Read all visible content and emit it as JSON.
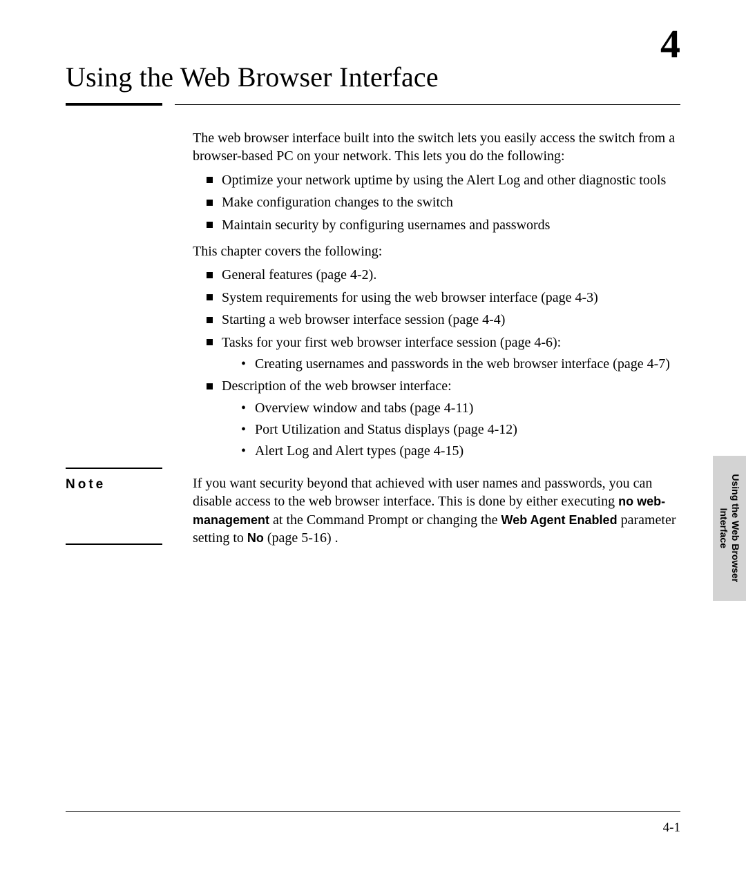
{
  "chapter_number": "4",
  "title": "Using the Web Browser Interface",
  "intro": "The web browser interface built into the switch lets you easily access the switch from a browser-based PC on your network. This lets you do the following:",
  "intro_bullets": [
    "Optimize your network uptime by using the Alert Log and other diagnostic tools",
    "Make configuration changes to the switch",
    "Maintain security by configuring usernames and passwords"
  ],
  "covers_line": "This chapter covers the following:",
  "topics": [
    "General features (page 4-2).",
    "System requirements for using the web browser interface (page 4-3)",
    "Starting a web browser interface session (page 4-4)",
    "Tasks for your first web browser interface session (page 4-6):",
    "Description of the web browser interface:"
  ],
  "subtopics_tasks": [
    "Creating usernames and passwords in the web browser interface (page 4-7)"
  ],
  "subtopics_desc": [
    "Overview window and tabs (page 4-11)",
    "Port Utilization and Status displays (page 4-12)",
    "Alert Log and Alert types (page 4-15)"
  ],
  "note_label": "Note",
  "note_seg1": "If you want security beyond that achieved with user names and passwords, you can disable access to the web browser interface. This is done by either executing ",
  "note_cmd1": "no web-management",
  "note_seg2": " at the Command Prompt  or changing the ",
  "note_cmd2": "Web Agent Enabled",
  "note_seg3": " parameter setting  to ",
  "note_cmd3": "No",
  "note_seg4": " (page 5-16) .",
  "side_tab_line1": "Using the Web Browser",
  "side_tab_line2": "Interface",
  "page_number": "4-1"
}
